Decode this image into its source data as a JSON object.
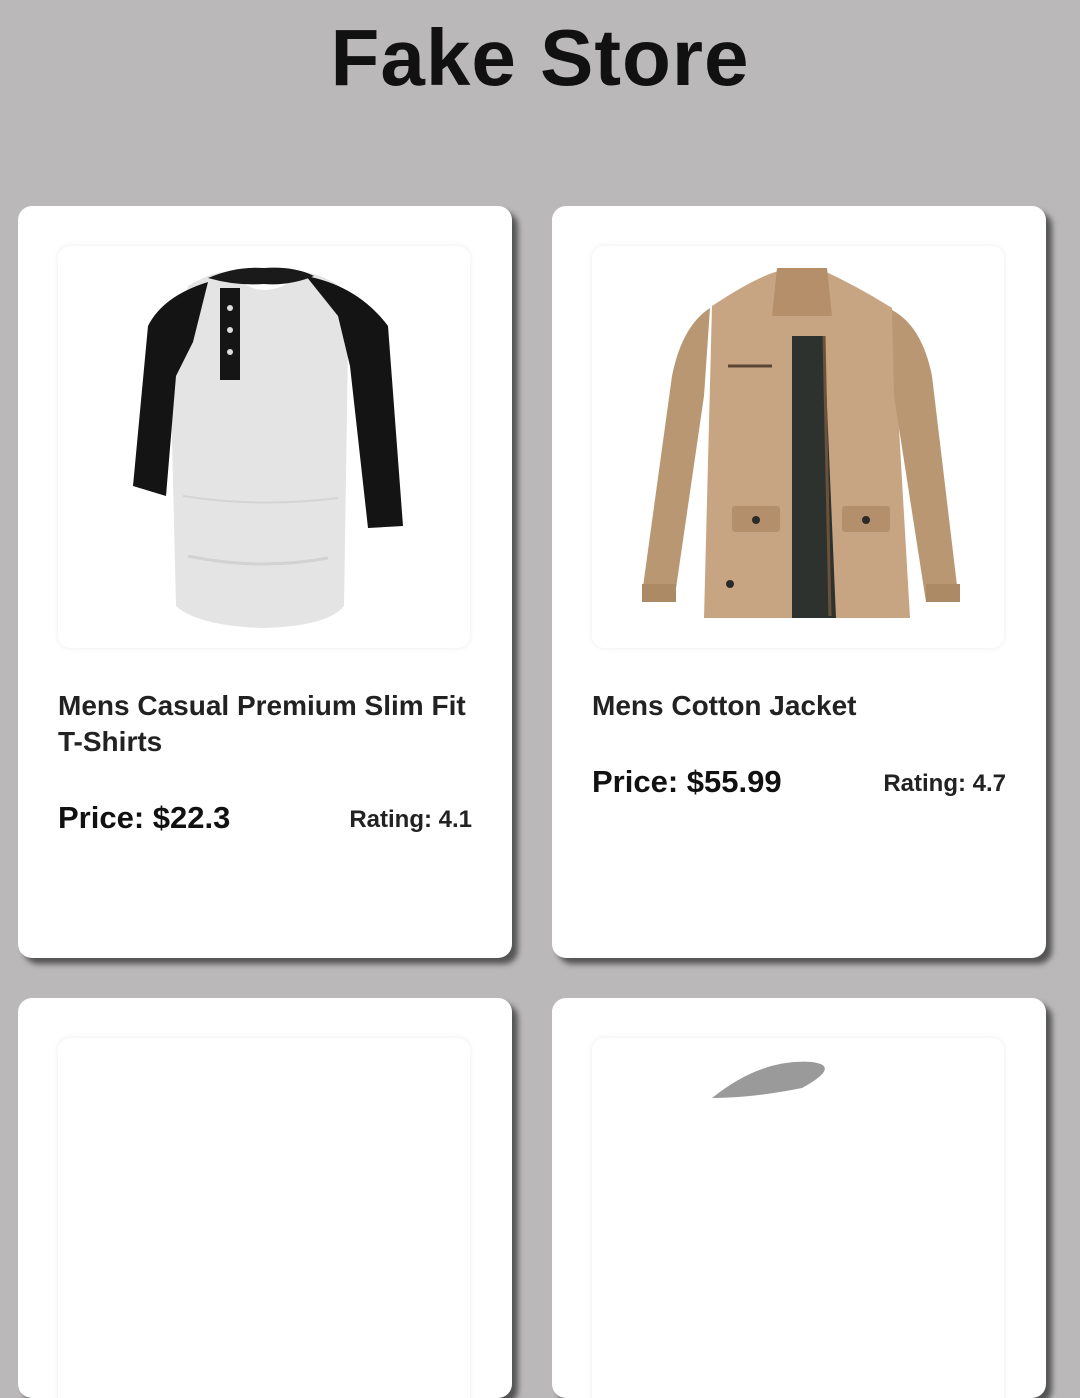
{
  "header": {
    "title": "Fake Store"
  },
  "products": [
    {
      "name": "Mens Casual Premium Slim Fit T-Shirts",
      "price": "Price: $22.3",
      "rating": "Rating: 4.1",
      "image": "raglan-henley-shirt"
    },
    {
      "name": "Mens Cotton Jacket",
      "price": "Price: $55.99",
      "rating": "Rating: 4.7",
      "image": "khaki-cotton-jacket"
    },
    {
      "image": "product-image"
    },
    {
      "image": "product-image"
    }
  ]
}
